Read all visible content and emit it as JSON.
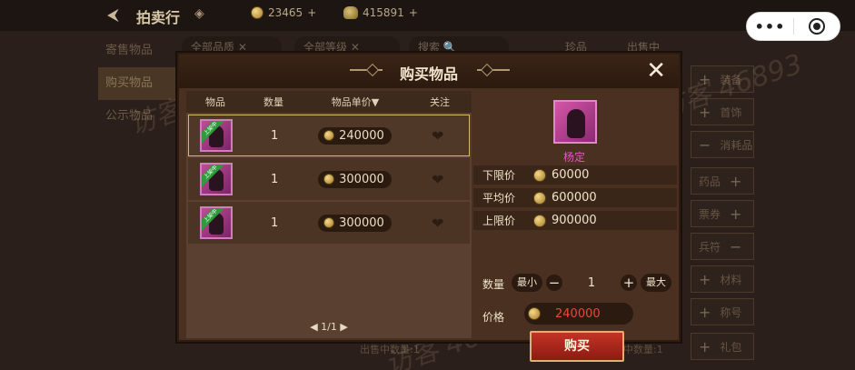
{
  "background": {
    "page_title": "拍卖行",
    "currency_gold": "23465",
    "currency_bag": "415891",
    "tabs": [
      "寄售物品",
      "购买物品",
      "公示物品"
    ],
    "filters": [
      "全部品质",
      "全部等级",
      "搜索"
    ],
    "filter_right": [
      "珍品",
      "出售中"
    ],
    "right_categories": [
      "装备",
      "首饰",
      "消耗品",
      "药品",
      "票券",
      "兵符",
      "材料",
      "称号",
      "礼包"
    ],
    "bottom_texts": [
      "出售中数量:1",
      "出售中数量:1"
    ],
    "watermark": "访客 46893"
  },
  "modal": {
    "title": "购买物品",
    "close_symbol": "✕",
    "columns": [
      "物品",
      "数量",
      "物品单价▼",
      "关注"
    ],
    "rows": [
      {
        "badge": "上架中",
        "qty": "1",
        "price": "240000"
      },
      {
        "badge": "上架中",
        "qty": "1",
        "price": "300000"
      },
      {
        "badge": "上架中",
        "qty": "1",
        "price": "300000"
      }
    ],
    "pager": "◀ 1/1 ▶",
    "detail": {
      "name": "杨定",
      "min_price_label": "下限价",
      "min_price": "60000",
      "avg_price_label": "平均价",
      "avg_price": "600000",
      "max_price_label": "上限价",
      "max_price": "900000",
      "qty_label": "数量",
      "qty_min": "最小",
      "qty_minus": "−",
      "qty_value": "1",
      "qty_plus": "+",
      "qty_max": "最大",
      "price_label": "价格",
      "price_value": "240000",
      "buy_label": "购买"
    }
  }
}
